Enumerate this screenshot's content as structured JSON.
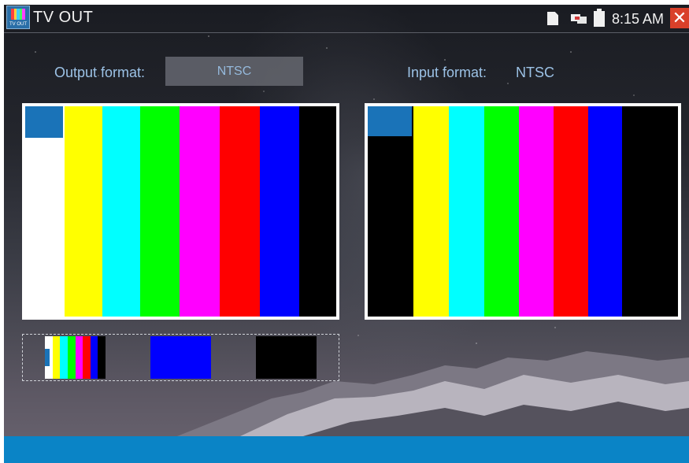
{
  "header": {
    "app_icon_caption": "TV OUT",
    "title": "TV OUT",
    "time": "8:15 AM",
    "icons": [
      "sd-card-icon",
      "network-icon",
      "battery-icon",
      "close-icon"
    ]
  },
  "output": {
    "label": "Output format:",
    "value": "NTSC"
  },
  "input": {
    "label": "Input format:",
    "value": "NTSC"
  },
  "colors": {
    "accent": "#0a84c6",
    "label_text": "#9cc2e6",
    "close": "#d9402a",
    "bar_white": "#ffffff",
    "bar_yellow": "#ffff00",
    "bar_cyan": "#00ffff",
    "bar_green": "#00ff00",
    "bar_magenta": "#ff00ff",
    "bar_red": "#ff0000",
    "bar_blue": "#0000ff",
    "bar_black": "#000000"
  },
  "previews": {
    "output_bars": [
      "white",
      "yellow",
      "cyan",
      "green",
      "magenta",
      "red",
      "blue",
      "black"
    ],
    "input_bars": [
      "black",
      "yellow",
      "cyan",
      "green",
      "magenta",
      "red",
      "blue",
      "black"
    ],
    "thumbnails": [
      "color-bars",
      "solid-blue",
      "solid-black"
    ]
  }
}
